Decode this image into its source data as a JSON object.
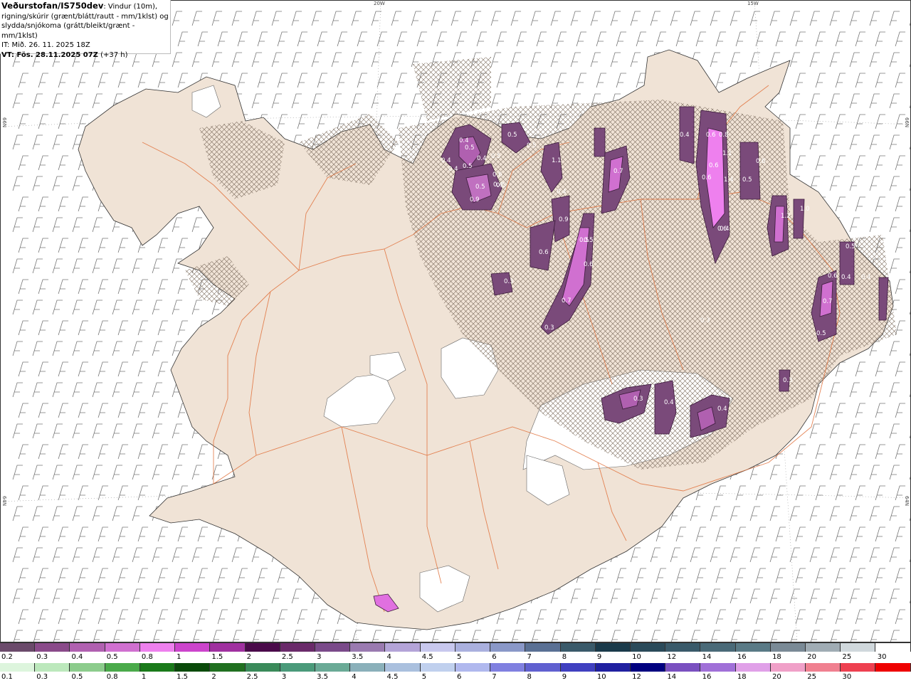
{
  "header": {
    "source": "Veðurstofan/IS750dev",
    "description": ": Vindur (10m), rigning/skúrir (grænt/blátt/rautt - mm/1klst) og slydda/snjókoma (grátt/bleikt/grænt - mm/1klst)",
    "it": "IT: Mið. 26. 11. 2025 18Z",
    "vt_bold": "VT: Fös. 28.11.2025 07Z",
    "vt_offset": "(+37 h)"
  },
  "grid_labels": {
    "lon_20w": "20W",
    "lon_15w": "15W",
    "lat_66n": "66N",
    "lat_64n": "64N"
  },
  "precip_labels": [
    "0.4",
    "0.5",
    "0.4",
    "0.4",
    "0.5",
    "0.4",
    "0.5",
    "0.6",
    "0.5",
    "0.9",
    "0.5",
    "0.4",
    "0.5",
    "0.5",
    "1.1",
    "0.4",
    "0.7",
    "0.5",
    "0.9",
    "0.6",
    "0.5",
    "0.6",
    "0.7",
    "0.3",
    "0.3",
    "0.4",
    "0.6",
    "0.8",
    "0.6",
    "0.6",
    "1.1",
    "1.4",
    "0.6",
    "0.5",
    "0.6",
    "0.4",
    "1.2",
    "1.0",
    "0.5",
    "0.4",
    "0.6",
    "0.4",
    "0.7",
    "0.5",
    "0.3",
    "0.3",
    "0.4",
    "0.4",
    "0.3"
  ],
  "colorbars": {
    "snow": {
      "colors": [
        "#6b4a6b",
        "#8a4a8a",
        "#b060b0",
        "#d070d0",
        "#ee80ee",
        "#cc44cc",
        "#a030a0",
        "#4a0a4a",
        "#6a2a6a",
        "#7a4a8a",
        "#9a7ab0",
        "#b4a4d8",
        "#c8c8ee",
        "#aab0de",
        "#8a98c8",
        "#5a7094",
        "#3a5a6a",
        "#1a3a4a",
        "#2a4a5a",
        "#3a5a6a",
        "#4a6a78",
        "#5a7a86",
        "#7a8a96",
        "#a0acb4",
        "#d0d8dc",
        "#ffffff"
      ],
      "labels": [
        "0.2",
        "0.3",
        "0.4",
        "0.5",
        "0.8",
        "1",
        "1.5",
        "2",
        "2.5",
        "3",
        "3.5",
        "4",
        "4.5",
        "5",
        "6",
        "7",
        "8",
        "9",
        "10",
        "12",
        "14",
        "16",
        "18",
        "20",
        "25",
        "30"
      ]
    },
    "rain": {
      "colors": [
        "#ddf5dd",
        "#bce8bc",
        "#8ccc8c",
        "#4aaa4a",
        "#1a7a1a",
        "#0a4a0a",
        "#207020",
        "#3a8a5a",
        "#4a9a7a",
        "#6aaa96",
        "#8ab0ba",
        "#aac0de",
        "#c0d0ee",
        "#b0b8ee",
        "#8080e0",
        "#6060d0",
        "#4040c0",
        "#2020a0",
        "#000080",
        "#7a50c0",
        "#a070d8",
        "#e0a0e8",
        "#f0a0c8",
        "#f08090",
        "#ee4050",
        "#ee0000"
      ],
      "labels": [
        "0.1",
        "0.3",
        "0.5",
        "0.8",
        "1",
        "1.5",
        "2",
        "2.5",
        "3",
        "3.5",
        "4",
        "4.5",
        "5",
        "6",
        "7",
        "8",
        "9",
        "10",
        "12",
        "14",
        "16",
        "18",
        "20",
        "25",
        "30"
      ]
    }
  }
}
